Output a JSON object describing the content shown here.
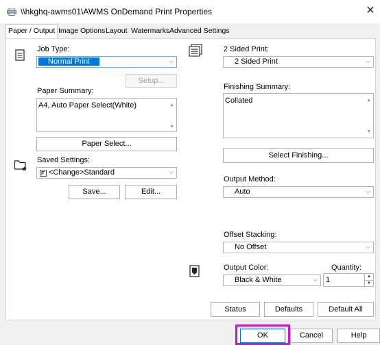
{
  "window": {
    "title": "\\\\hkghq-awms01\\AWMS OnDemand Print Properties",
    "close_glyph": "✕"
  },
  "tabs": [
    {
      "label": "Paper / Output",
      "active": true
    },
    {
      "label": "Image Options"
    },
    {
      "label": "Layout"
    },
    {
      "label": "Watermarks"
    },
    {
      "label": "Advanced Settings"
    }
  ],
  "left": {
    "job_type_label": "Job Type:",
    "job_type_value": "Normal Print",
    "setup_button": "Setup...",
    "paper_summary_label": "Paper Summary:",
    "paper_summary_value": "A4, Auto Paper Select(White)",
    "paper_select_button": "Paper Select...",
    "saved_settings_label": "Saved Settings:",
    "saved_settings_value": "<Change>Standard",
    "save_button": "Save...",
    "edit_button": "Edit..."
  },
  "right": {
    "two_sided_label": "2 Sided Print:",
    "two_sided_value": "2 Sided Print",
    "finishing_summary_label": "Finishing Summary:",
    "finishing_summary_value": "Collated",
    "select_finishing_button": "Select Finishing...",
    "output_method_label": "Output Method:",
    "output_method_value": "Auto",
    "offset_stacking_label": "Offset Stacking:",
    "offset_stacking_value": "No Offset",
    "output_color_label": "Output Color:",
    "output_color_value": "Black & White",
    "quantity_label": "Quantity:",
    "quantity_value": "1"
  },
  "panel_buttons": {
    "status": "Status",
    "defaults": "Defaults",
    "default_all": "Default All"
  },
  "dialog_buttons": {
    "ok": "OK",
    "cancel": "Cancel",
    "help": "Help"
  },
  "icons": {
    "dropdown": "⌵",
    "scroll_up": "▲",
    "scroll_down": "▼"
  },
  "colors": {
    "selection": "#0078d7",
    "ok_highlight": "#c71ac7"
  }
}
